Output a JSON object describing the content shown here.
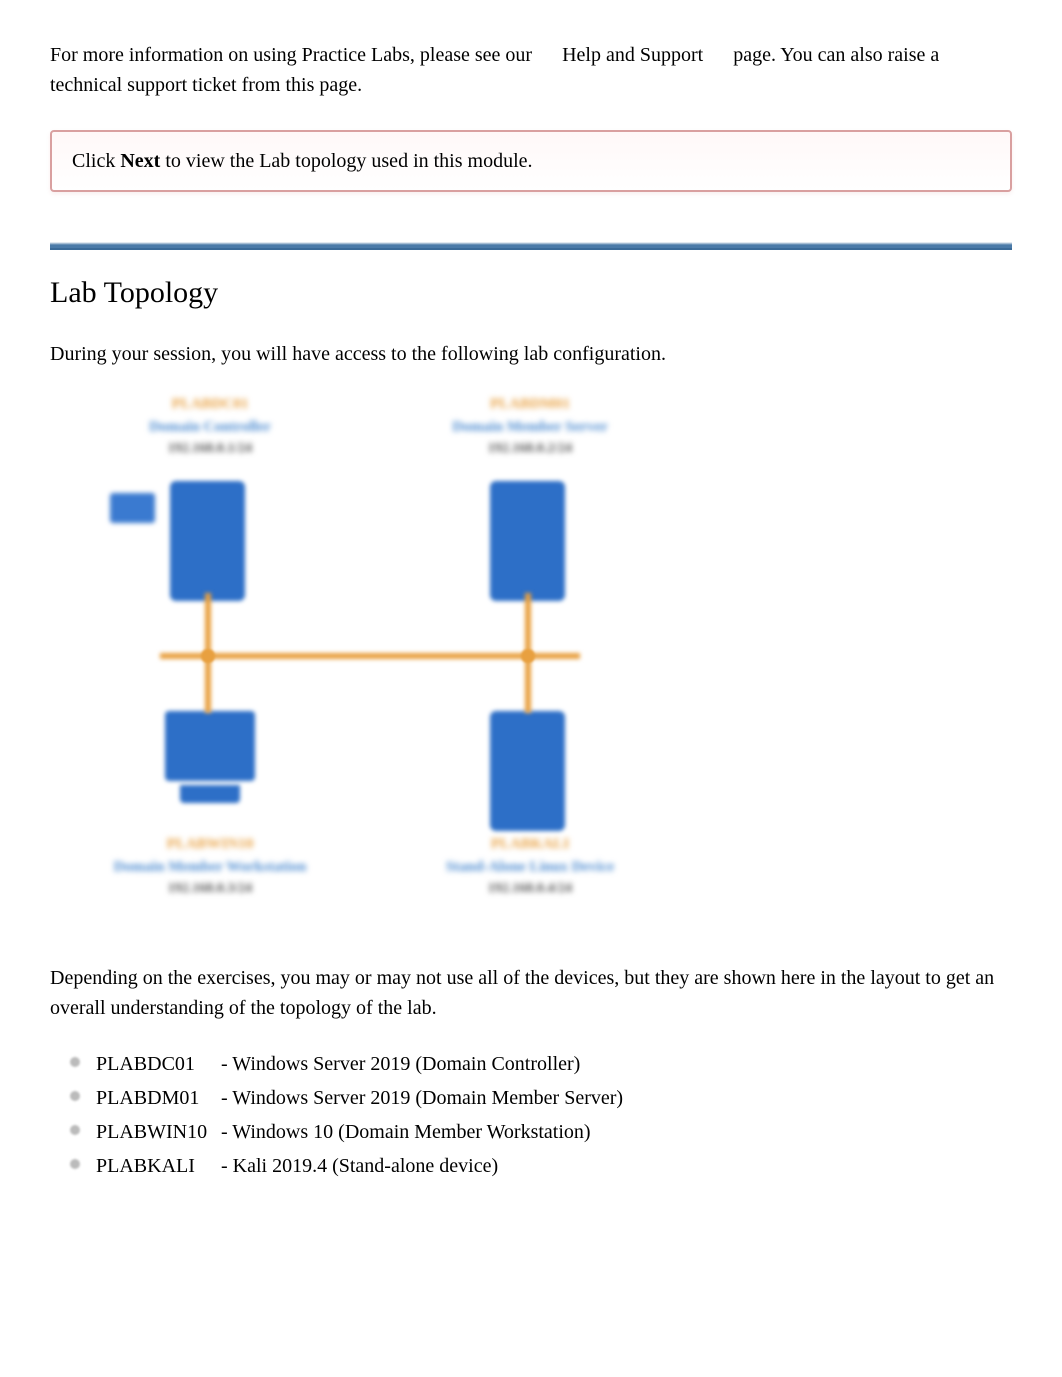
{
  "intro": {
    "prefix": "For more information on using Practice Labs, please see our",
    "link": "Help and Support",
    "suffix": "page. You can also raise a technical support ticket from this page."
  },
  "nextBox": {
    "prefix": "Click ",
    "bold": "Next",
    "suffix": " to view the Lab topology used in this module."
  },
  "section": {
    "heading": "Lab Topology",
    "intro": "During your session, you will have access to the following lab configuration.",
    "desc": "Depending on the exercises, you may or may not use all of the devices, but they are shown here in the layout to get an overall understanding of the topology of the lab."
  },
  "diagram": {
    "nodes": [
      {
        "name": "PLABDC01",
        "role": "Domain Controller",
        "ip": "192.168.0.1/24"
      },
      {
        "name": "PLABDM01",
        "role": "Domain Member Server",
        "ip": "192.168.0.2/24"
      },
      {
        "name": "PLABWIN10",
        "role": "Domain Member Workstation",
        "ip": "192.168.0.3/24"
      },
      {
        "name": "PLABKALI",
        "role": "Stand-Alone Linux Device",
        "ip": "192.168.0.4/24"
      }
    ]
  },
  "devices": [
    {
      "name": "PLABDC01",
      "desc": "- Windows Server 2019 (Domain Controller)"
    },
    {
      "name": "PLABDM01",
      "desc": "- Windows Server 2019 (Domain Member Server)"
    },
    {
      "name": "PLABWIN10",
      "desc": "- Windows 10 (Domain Member Workstation)"
    },
    {
      "name": "PLABKALI",
      "desc": "- Kali 2019.4 (Stand-alone device)"
    }
  ]
}
